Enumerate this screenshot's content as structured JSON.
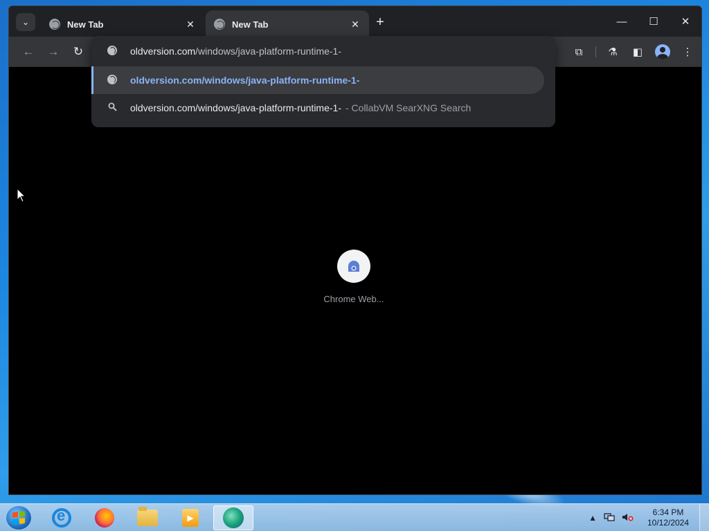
{
  "browser": {
    "tabs": [
      {
        "label": "New Tab",
        "active": false
      },
      {
        "label": "New Tab",
        "active": true
      }
    ],
    "icons": {
      "tab_search": "chevron-down-icon",
      "new_tab": "plus-icon",
      "back": "arrow-left-icon",
      "forward": "arrow-right-icon",
      "reload": "reload-icon",
      "extensions": "puzzle-icon",
      "labs": "flask-icon",
      "side_panel": "side-panel-icon",
      "profile": "avatar-icon",
      "menu": "kebab-menu-icon"
    },
    "glyphs": {
      "tab_search": "⌄",
      "tab_close": "✕",
      "new_tab": "+",
      "back": "←",
      "forward": "→",
      "reload": "↻",
      "minimize": "—",
      "maximize": "☐",
      "close": "✕",
      "extensions": "⧉",
      "labs": "⚗",
      "side_panel": "◧",
      "menu": "⋮",
      "search": "🔍"
    }
  },
  "omnibox": {
    "input": {
      "host": "oldversion.com",
      "path": "/windows/java-platform-runtime-1-"
    },
    "suggestions": [
      {
        "type": "url",
        "text": "oldversion.com/windows/java-platform-runtime-1-",
        "selected": true
      },
      {
        "type": "search",
        "text": "oldversion.com/windows/java-platform-runtime-1-",
        "source": "- CollabVM SearXNG Search",
        "selected": false
      }
    ]
  },
  "new_tab_page": {
    "shortcuts": [
      {
        "label": "Chrome Web...",
        "icon": "chrome-web-store-icon"
      }
    ]
  },
  "taskbar": {
    "items": [
      {
        "name": "internet-explorer",
        "icon": "ie-icon"
      },
      {
        "name": "firefox",
        "icon": "firefox-icon"
      },
      {
        "name": "file-explorer",
        "icon": "folder-icon"
      },
      {
        "name": "media-player",
        "icon": "media-player-icon"
      },
      {
        "name": "browser",
        "icon": "browser-icon",
        "active": true
      }
    ],
    "tray": {
      "show_hidden": "▲",
      "clock_time": "6:34 PM",
      "clock_date": "10/12/2024"
    }
  },
  "colors": {
    "accent": "#8ab4f8",
    "toolbar": "#35363a",
    "tabstrip": "#202124",
    "content_bg": "#000000"
  }
}
